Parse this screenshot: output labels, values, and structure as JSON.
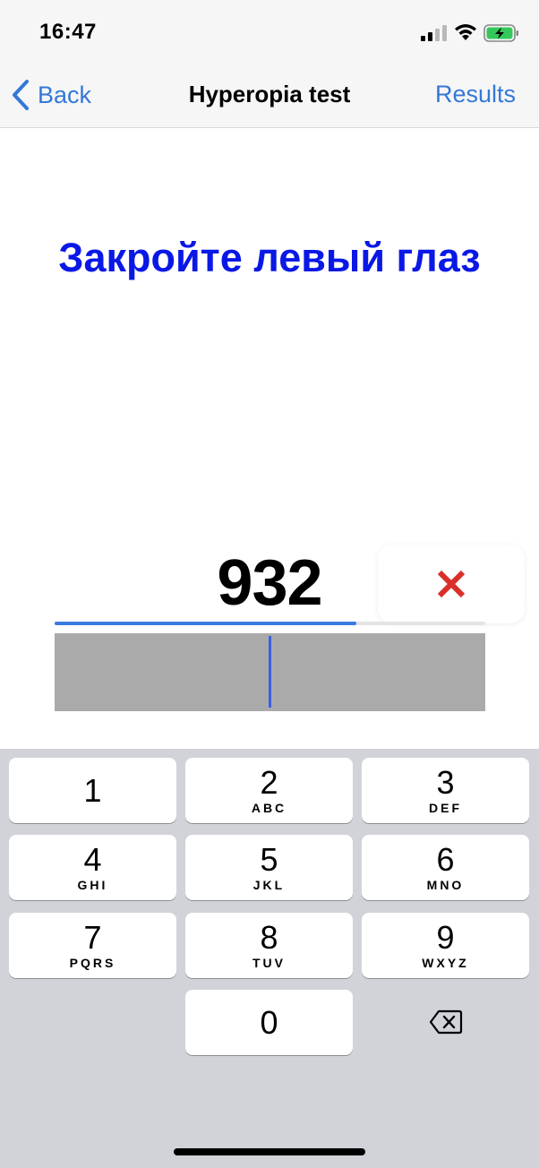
{
  "status": {
    "time": "16:47",
    "signal_icon": "signal-icon",
    "wifi_icon": "wifi-icon",
    "battery_icon": "battery-charging-icon"
  },
  "nav": {
    "back_label": "Back",
    "title": "Hyperopia test",
    "results_label": "Results"
  },
  "main": {
    "instruction": "Закройте левый глаз",
    "number": "932",
    "clear_icon": "close-icon",
    "progress": 0.7,
    "slider_value": 0.5
  },
  "keypad": {
    "keys": [
      {
        "digit": "1",
        "letters": ""
      },
      {
        "digit": "2",
        "letters": "ABC"
      },
      {
        "digit": "3",
        "letters": "DEF"
      },
      {
        "digit": "4",
        "letters": "GHI"
      },
      {
        "digit": "5",
        "letters": "JKL"
      },
      {
        "digit": "6",
        "letters": "MNO"
      },
      {
        "digit": "7",
        "letters": "PQRS"
      },
      {
        "digit": "8",
        "letters": "TUV"
      },
      {
        "digit": "9",
        "letters": "WXYZ"
      },
      {
        "digit": "0",
        "letters": ""
      }
    ],
    "delete_icon": "backspace-icon"
  },
  "colors": {
    "accent": "#3478d6",
    "instruction": "#0a18e6",
    "clear": "#d9302a",
    "progress": "#3a7be0",
    "slider_bg": "#aaaaaa",
    "keypad_bg": "#d1d3d9"
  }
}
